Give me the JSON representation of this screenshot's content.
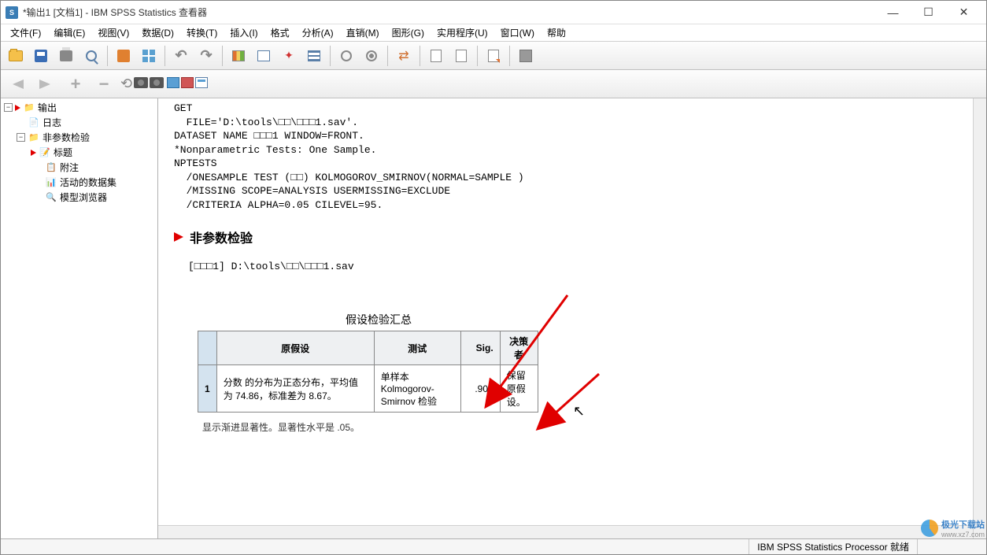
{
  "window": {
    "title": "*输出1 [文档1] - IBM SPSS Statistics 查看器"
  },
  "menu": {
    "items": [
      "文件(F)",
      "编辑(E)",
      "视图(V)",
      "数据(D)",
      "转换(T)",
      "插入(I)",
      "格式",
      "分析(A)",
      "直销(M)",
      "图形(G)",
      "实用程序(U)",
      "窗口(W)",
      "帮助"
    ]
  },
  "tree": {
    "root": "输出",
    "log": "日志",
    "npar": "非参数检验",
    "title": "标题",
    "note": "附注",
    "dataset": "活动的数据集",
    "model": "模型浏览器"
  },
  "syntax": {
    "line1": "GET",
    "line2": "  FILE='D:\\tools\\□□\\□□□1.sav'.",
    "line3": "DATASET NAME □□□1 WINDOW=FRONT.",
    "line4": "*Nonparametric Tests: One Sample.",
    "line5": "NPTESTS",
    "line6": "  /ONESAMPLE TEST (□□) KOLMOGOROV_SMIRNOV(NORMAL=SAMPLE )",
    "line7": "  /MISSING SCOPE=ANALYSIS USERMISSING=EXCLUDE",
    "line8": "  /CRITERIA ALPHA=0.05 CILEVEL=95."
  },
  "section": {
    "heading": "非参数检验",
    "dataset_line": "[□□□1] D:\\tools\\□□\\□□□1.sav"
  },
  "chart_data": {
    "type": "table",
    "title": "假设检验汇总",
    "columns": [
      "",
      "原假设",
      "测试",
      "Sig.",
      "决策者"
    ],
    "rows": [
      {
        "num": "1",
        "h0": "分数 的分布为正态分布，平均值为 74.86，标准差为 8.67。",
        "test": "单样本 Kolmogorov-Smirnov 检验",
        "sig": ".909",
        "decision": "保留原假设。"
      }
    ],
    "footnote": "显示渐进显著性。显著性水平是 .05。"
  },
  "status": {
    "processor": "IBM SPSS Statistics Processor 就绪"
  },
  "watermark": {
    "text": "极光下载站",
    "url": "www.xz7.com"
  }
}
